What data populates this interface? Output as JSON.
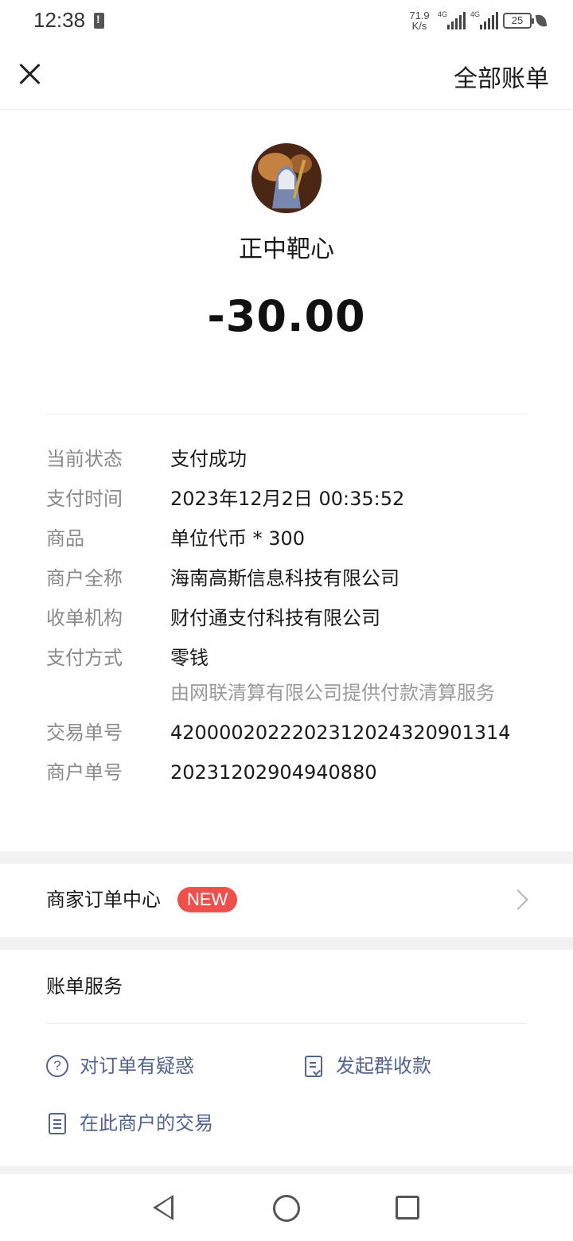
{
  "status_bar": {
    "time": "12:38",
    "net_speed_value": "71.9",
    "net_speed_unit": "K/s",
    "signal_1_tag": "4G",
    "signal_2_tag": "4G",
    "battery_level": "25"
  },
  "header": {
    "close_icon": "close-icon",
    "all_bills_label": "全部账单"
  },
  "merchant": {
    "name": "正中靶心",
    "amount": "-30.00"
  },
  "details": [
    {
      "label": "当前状态",
      "value": "支付成功"
    },
    {
      "label": "支付时间",
      "value": "2023年12月2日 00:35:52"
    },
    {
      "label": "商品",
      "value": "单位代币 * 300"
    },
    {
      "label": "商户全称",
      "value": "海南高斯信息科技有限公司"
    },
    {
      "label": "收单机构",
      "value": "财付通支付科技有限公司"
    },
    {
      "label": "支付方式",
      "value": "零钱",
      "sub": "由网联清算有限公司提供付款清算服务"
    },
    {
      "label": "交易单号",
      "value": "4200002022202312024320901314"
    },
    {
      "label": "商户单号",
      "value": "20231202904940880"
    }
  ],
  "order_center": {
    "label": "商家订单中心",
    "badge": "NEW"
  },
  "bill_service": {
    "title": "账单服务",
    "items": [
      {
        "label": "对订单有疑惑",
        "icon": "question-icon"
      },
      {
        "label": "发起群收款",
        "icon": "document-check-icon"
      },
      {
        "label": "在此商户的交易",
        "icon": "document-icon"
      }
    ]
  },
  "colors": {
    "link": "#52648e",
    "badge": "#f0504c",
    "label_gray": "#8a8a8a"
  }
}
